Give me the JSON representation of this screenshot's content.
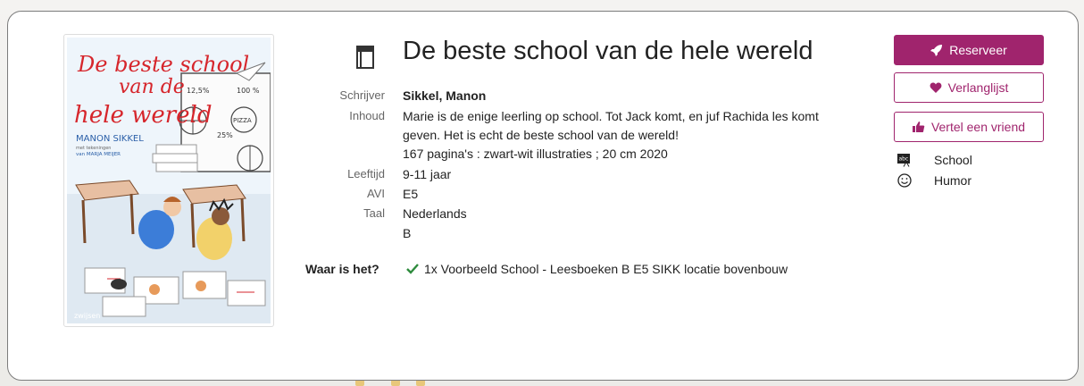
{
  "book": {
    "title": "De beste school van de hele wereld",
    "fields": {
      "author_label": "Schrijver",
      "author": "Sikkel, Manon",
      "content_label": "Inhoud",
      "content": "Marie is de enige leerling op school. Tot Jack komt, en juf Rachida les komt geven. Het is echt de beste school van de wereld!",
      "physical": "167 pagina's : zwart-wit illustraties ; 20 cm 2020",
      "age_label": "Leeftijd",
      "age": "9-11 jaar",
      "avi_label": "AVI",
      "avi": "E5",
      "language_label": "Taal",
      "language": "Nederlands",
      "level": "B"
    },
    "availability": {
      "label": "Waar is het?",
      "text": "1x Voorbeeld School - Leesboeken B E5 SIKK locatie bovenbouw",
      "check_color": "#2e8b3d"
    },
    "cover": {
      "title_line1": "De beste school",
      "title_line2": "van de",
      "title_line3": "hele wereld",
      "author": "MANON SIKKEL",
      "illustrator_line1": "met tekeningen",
      "illustrator_line2": "van MARJA MEIJER",
      "publisher": "zwijsen",
      "board_1": "12,5%",
      "board_2": "100 %",
      "board_3": "25%",
      "board_pizza": "PIZZA"
    }
  },
  "actions": {
    "reserve": "Reserveer",
    "wishlist": "Verlanglijst",
    "tell_friend": "Vertel een vriend",
    "accent_color": "#a0246d"
  },
  "tags": [
    {
      "label": "School",
      "icon": "school-abc-icon"
    },
    {
      "label": "Humor",
      "icon": "smiley-icon"
    }
  ]
}
